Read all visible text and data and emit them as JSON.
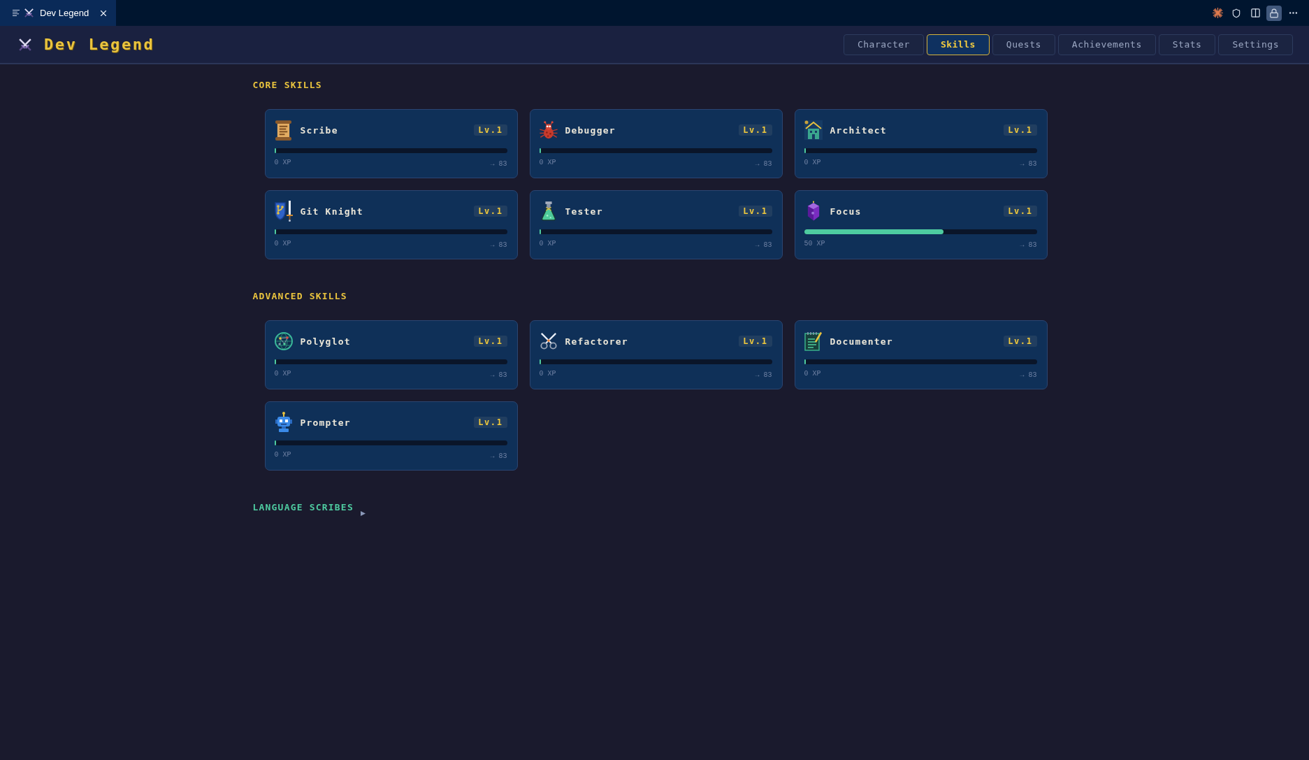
{
  "editor_tabs": [
    {
      "title": "Dev Legend",
      "selected": true
    }
  ],
  "editor_lock": {
    "on": true
  },
  "header": {
    "title": "Dev Legend"
  },
  "nav_tabs": [
    {
      "label": "Character",
      "selected": false
    },
    {
      "label": "Skills",
      "selected": true
    },
    {
      "label": "Quests",
      "selected": false
    },
    {
      "label": "Achievements",
      "selected": false
    },
    {
      "label": "Stats",
      "selected": false
    },
    {
      "label": "Settings",
      "selected": false
    }
  ],
  "sections": [
    {
      "title": "CORE SKILLS",
      "kind": "grid",
      "skills": [
        {
          "name": "Scribe",
          "badge": "Lv.1",
          "level": 0,
          "xp": "0 XP",
          "next": "→ 83"
        },
        {
          "name": "Debugger",
          "badge": "Lv.1",
          "level": 0,
          "xp": "0 XP",
          "next": "→ 83"
        },
        {
          "name": "Architect",
          "badge": "Lv.1",
          "level": 0,
          "xp": "0 XP",
          "next": "→ 83"
        },
        {
          "name": "Git Knight",
          "badge": "Lv.1",
          "level": 0,
          "xp": "0 XP",
          "next": "→ 83"
        },
        {
          "name": "Tester",
          "badge": "Lv.1",
          "level": 0,
          "xp": "0 XP",
          "next": "→ 83"
        },
        {
          "name": "Focus",
          "badge": "Lv.1",
          "level": 0.6,
          "xp": "50 XP",
          "next": "→ 83"
        }
      ]
    },
    {
      "title": "ADVANCED SKILLS",
      "kind": "grid",
      "skills": [
        {
          "name": "Polyglot",
          "badge": "Lv.1",
          "level": 0,
          "xp": "0 XP",
          "next": "→ 83"
        },
        {
          "name": "Refactorer",
          "badge": "Lv.1",
          "level": 0,
          "xp": "0 XP",
          "next": "→ 83"
        },
        {
          "name": "Documenter",
          "badge": "Lv.1",
          "level": 0,
          "xp": "0 XP",
          "next": "→ 83"
        },
        {
          "name": "Prompter",
          "badge": "Lv.1",
          "level": 0,
          "xp": "0 XP",
          "next": "→ 83"
        }
      ]
    },
    {
      "title": "LANGUAGE SCRIBES",
      "kind": "collapsible",
      "expanded": false
    }
  ]
}
